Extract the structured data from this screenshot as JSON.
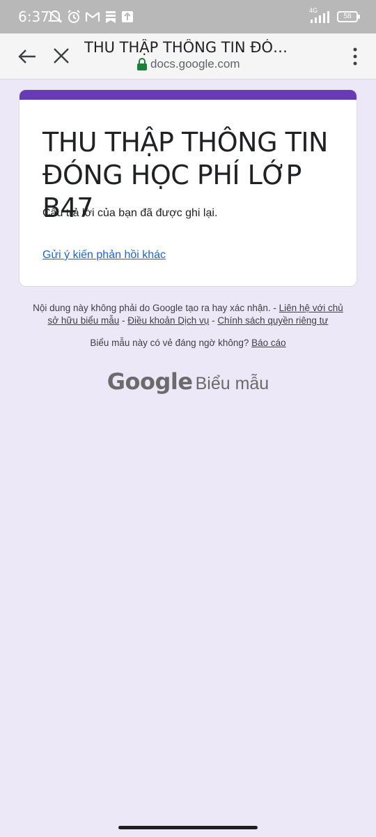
{
  "status_bar": {
    "time": "6:37",
    "network": "4G",
    "battery": "58"
  },
  "browser": {
    "page_title": "THU THẬP THÔNG TIN ĐÓNG HỌC PHÍ LỚP B47",
    "domain": "docs.google.com"
  },
  "form": {
    "accent_color": "#673ab7",
    "title": "THU THẬP THÔNG TIN ĐÓNG HỌC PHÍ LỚP B47",
    "confirmation": "Câu trả lời của bạn đã được ghi lại.",
    "submit_another": "Gửi ý kiến phản hồi khác"
  },
  "footer": {
    "disclaimer": "Nội dung này không phải do Google tạo ra hay xác nhận. - ",
    "contact_owner": "Liên hệ với chủ sở hữu biểu mẫu",
    "sep1": " - ",
    "terms": "Điều khoản Dịch vụ",
    "sep2": " - ",
    "privacy": "Chính sách quyền riêng tư",
    "suspicious": "Biểu mẫu này có vẻ đáng ngờ không? ",
    "report": "Báo cáo",
    "logo_brand": "Google",
    "logo_product": "Biểu mẫu"
  }
}
